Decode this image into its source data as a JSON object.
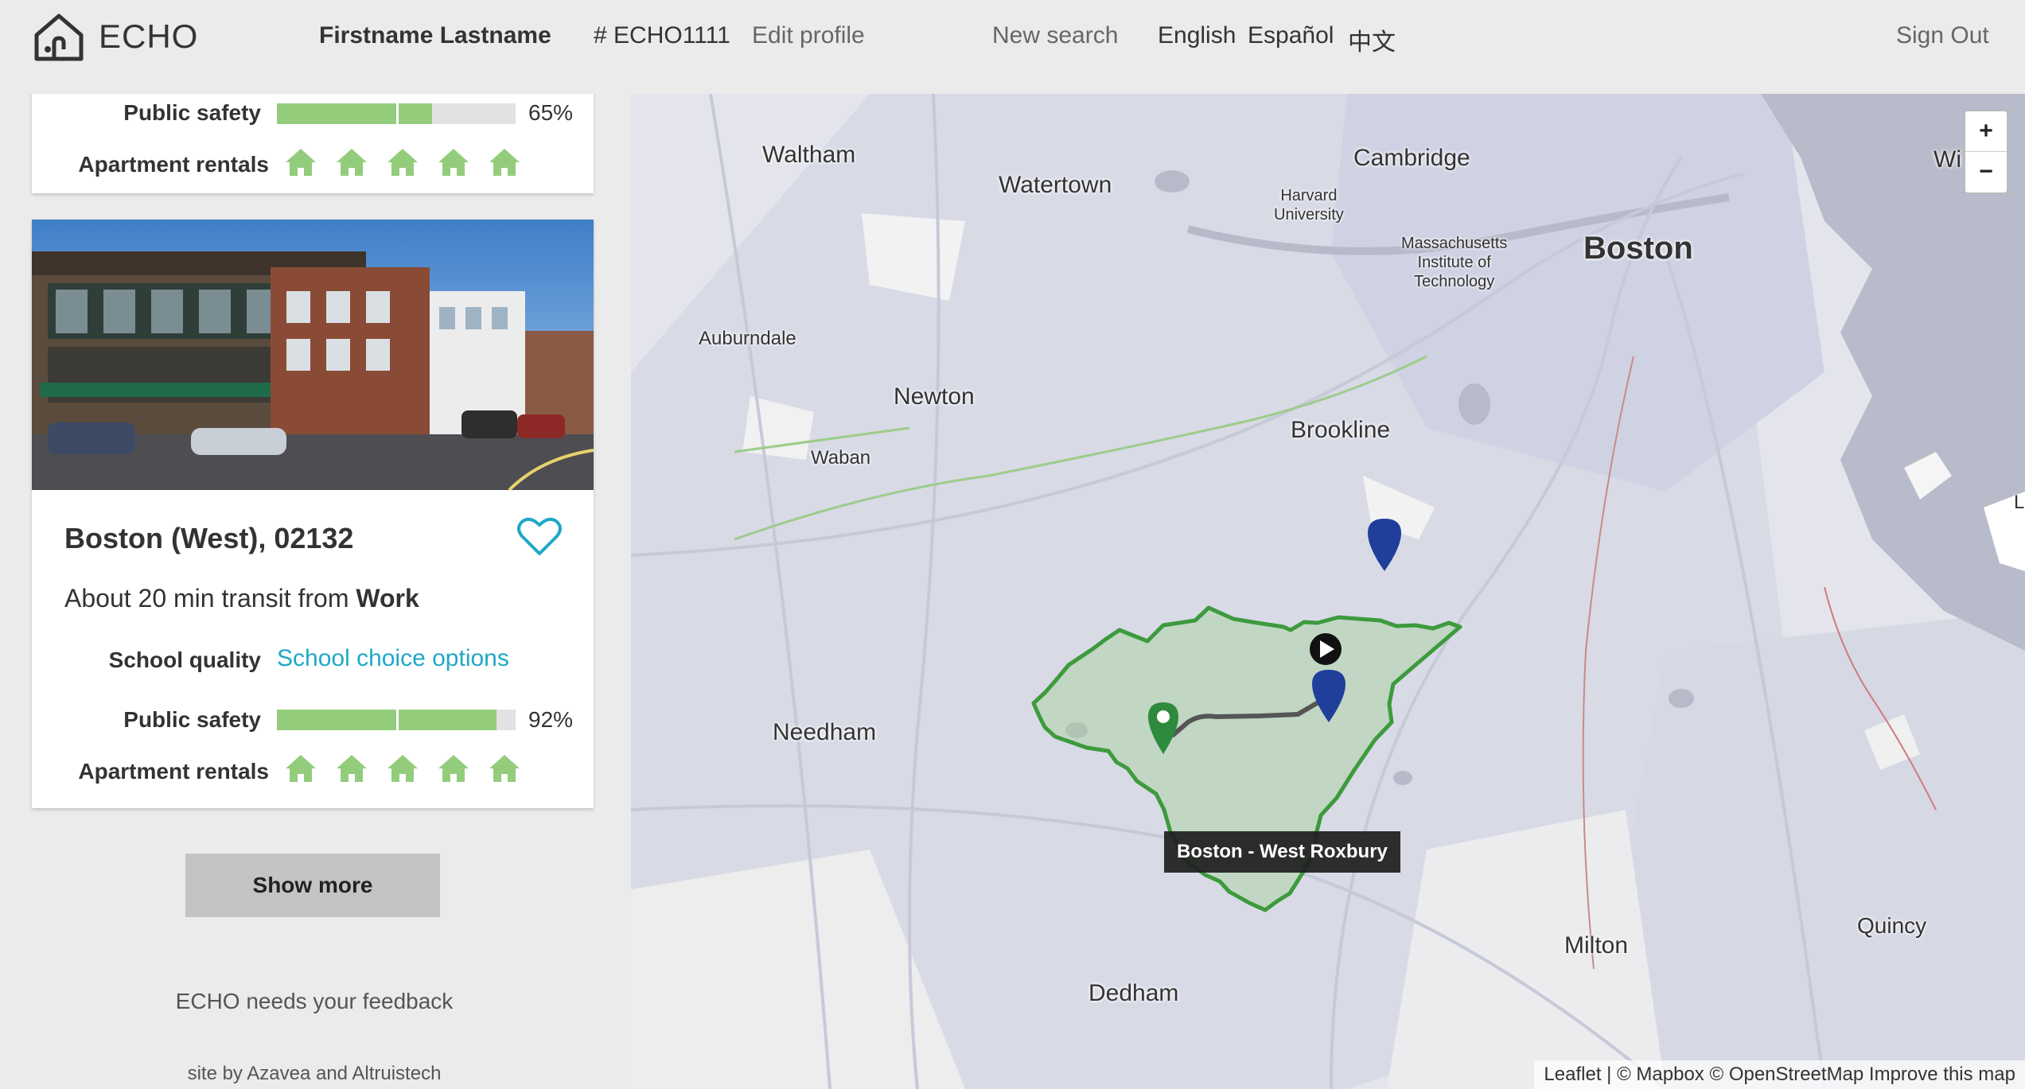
{
  "header": {
    "logo_text": "ECHO",
    "user_name": "Firstname Lastname",
    "user_id": "# ECHO1111",
    "edit_profile": "Edit profile",
    "new_search": "New search",
    "languages": [
      "English",
      "Español",
      "中文"
    ],
    "sign_out": "Sign Out"
  },
  "cards": [
    {
      "public_safety_label": "Public safety",
      "public_safety_value": "65%",
      "public_safety_level": 0.65,
      "apartment_rentals_label": "Apartment rentals",
      "apartment_rentals_count": 5
    },
    {
      "title": "Boston (West), 02132",
      "transit_prefix": "About 20 min transit from",
      "transit_target": "Work",
      "school_quality_label": "School quality",
      "school_quality_link": "School choice options",
      "public_safety_label": "Public safety",
      "public_safety_value": "92%",
      "public_safety_level": 0.92,
      "apartment_rentals_label": "Apartment rentals",
      "apartment_rentals_count": 5
    }
  ],
  "show_more": "Show more",
  "feedback": "ECHO needs your feedback",
  "site_by": "site by Azavea and Altruistech",
  "map": {
    "places": {
      "waltham": "Waltham",
      "watertown": "Watertown",
      "cambridge": "Cambridge",
      "harvard": "Harvard\nUniversity",
      "mit": "Massachusetts\nInstitute of\nTechnology",
      "boston": "Boston",
      "auburndale": "Auburndale",
      "newton": "Newton",
      "waban": "Waban",
      "brookline": "Brookline",
      "needham": "Needham",
      "dedham": "Dedham",
      "milton": "Milton",
      "quincy": "Quincy",
      "edge_top_right": "Wi",
      "edge_right": "L"
    },
    "zoom_in": "+",
    "zoom_out": "−",
    "tooltip": "Boston - West Roxbury",
    "attribution": {
      "leaflet": "Leaflet",
      "mapbox": "© Mapbox",
      "osm": "© OpenStreetMap",
      "improve": "Improve this map"
    },
    "colors": {
      "neighborhood_outline": "#3d9a3d",
      "selected_marker": "#2e8b3d",
      "result_marker": "#1f3f9a",
      "route": "#555555"
    }
  }
}
